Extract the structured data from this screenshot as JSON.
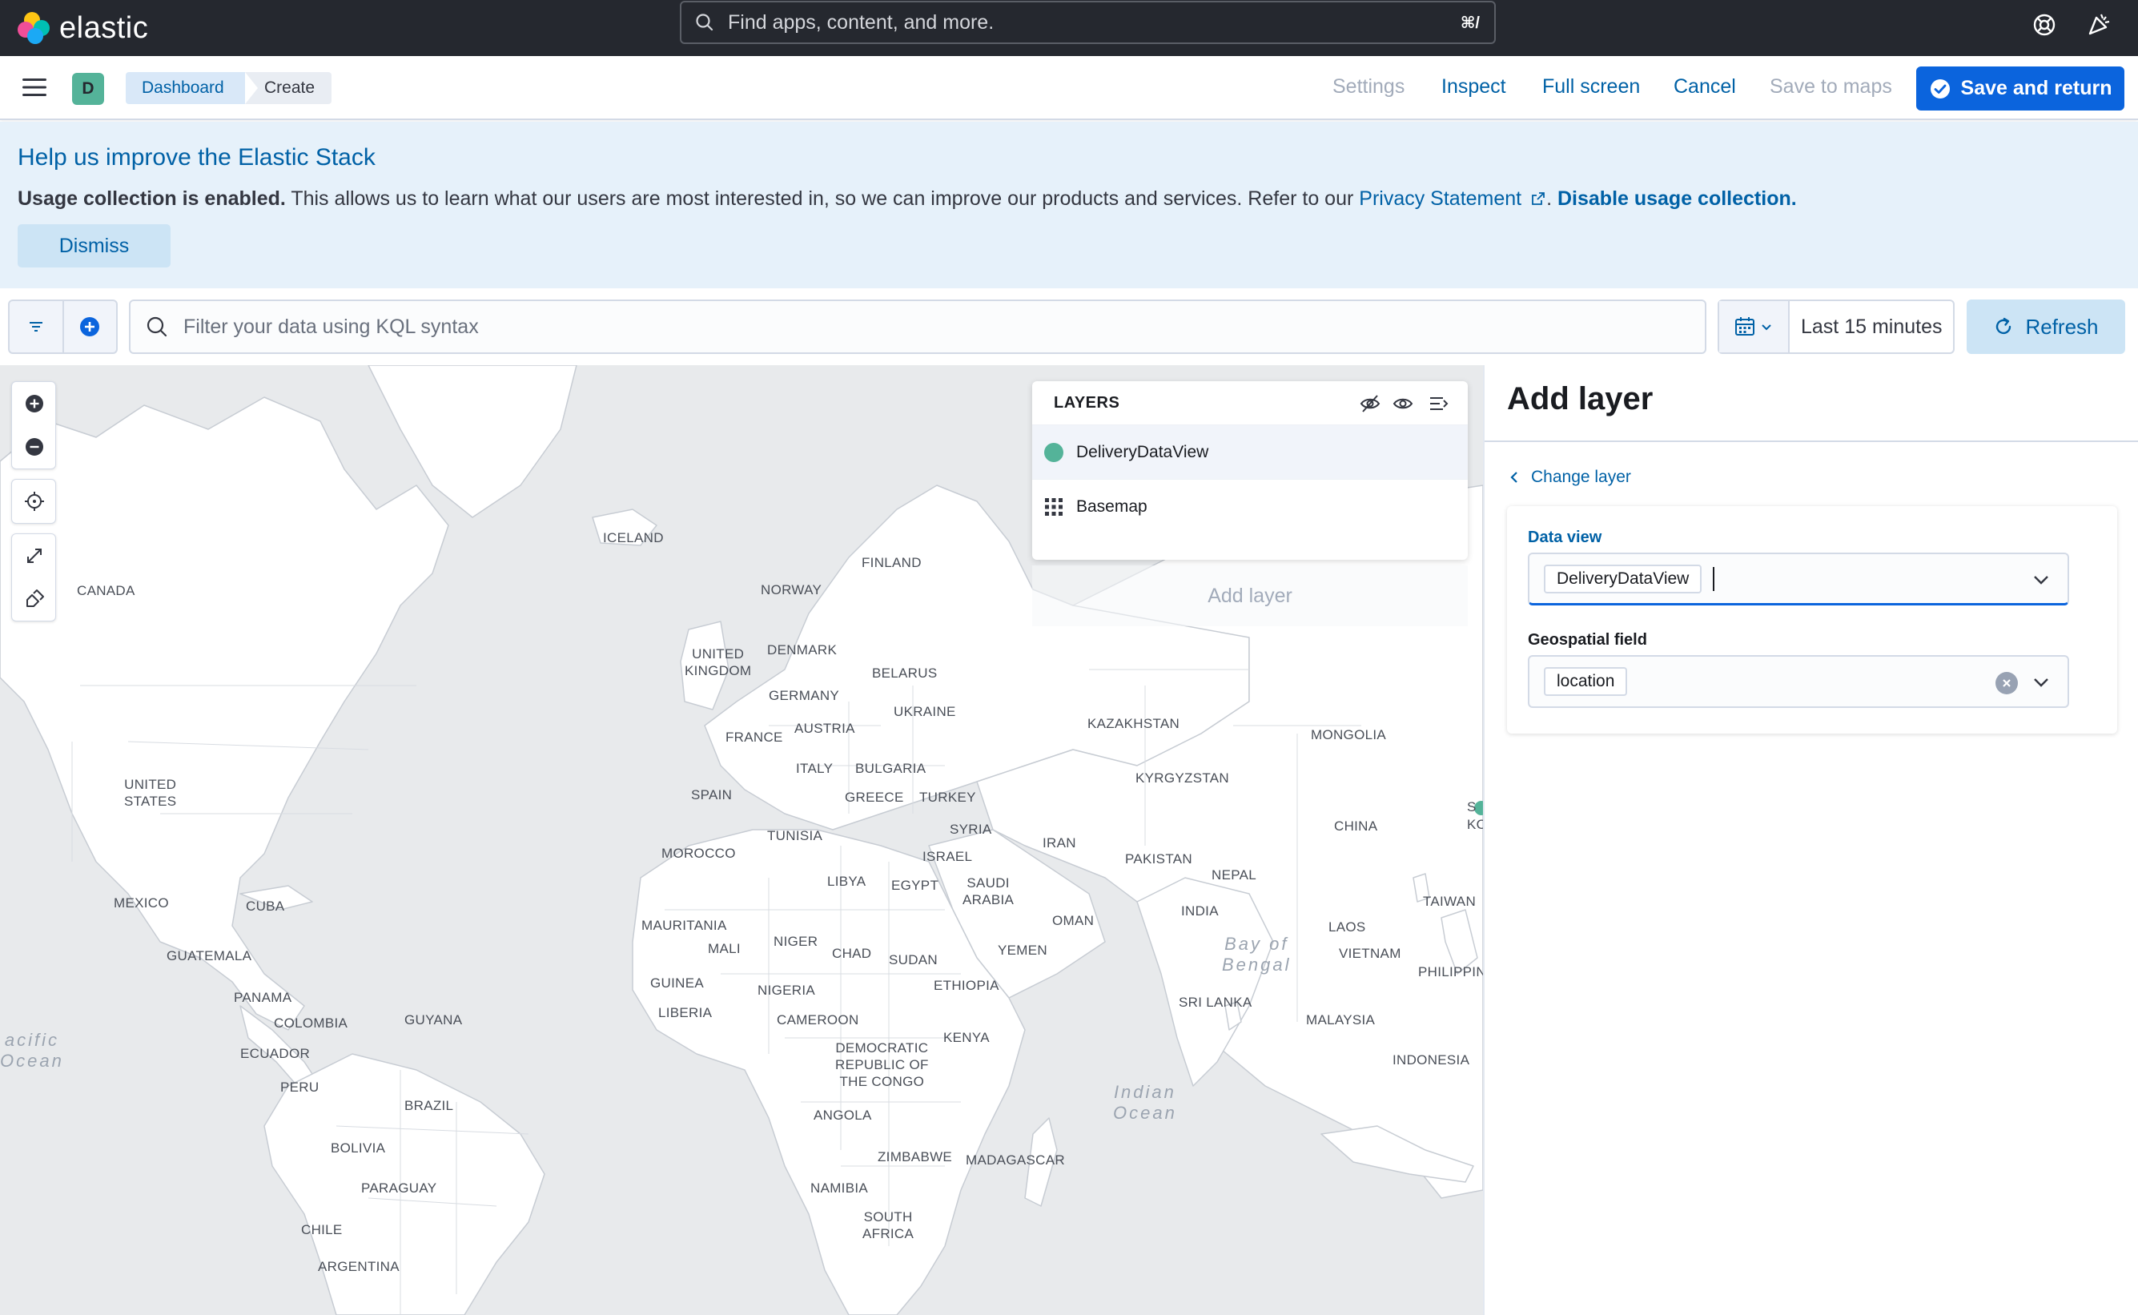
{
  "header": {
    "brand": "elastic",
    "search_placeholder": "Find apps, content, and more.",
    "search_shortcut": "⌘/",
    "icons": [
      "help-icon",
      "news-feed-icon"
    ]
  },
  "appbar": {
    "space_initial": "D",
    "breadcrumbs": [
      "Dashboard",
      "Create"
    ],
    "links": {
      "settings": "Settings",
      "inspect": "Inspect",
      "full_screen": "Full screen",
      "cancel": "Cancel",
      "save_to_maps": "Save to maps"
    },
    "primary_button": "Save and return"
  },
  "callout": {
    "title": "Help us improve the Elastic Stack",
    "bold_lead": "Usage collection is enabled.",
    "body": " This allows us to learn what our users are most interested in, so we can improve our products and services. Refer to our ",
    "privacy_link": "Privacy Statement",
    "separator": ". ",
    "disable_link": "Disable usage collection.",
    "dismiss": "Dismiss"
  },
  "query": {
    "placeholder": "Filter your data using KQL syntax",
    "time_range": "Last 15 minutes",
    "refresh": "Refresh"
  },
  "layers_panel": {
    "title": "LAYERS",
    "items": [
      {
        "label": "DeliveryDataView",
        "icon": "dot-icon",
        "color": "#54b399"
      },
      {
        "label": "Basemap",
        "icon": "grid-icon"
      }
    ],
    "add_layer": "Add layer"
  },
  "map_labels": {
    "iceland": "ICELAND",
    "finland": "FINLAND",
    "norway": "NORWAY",
    "canada": "CANADA",
    "united_kingdom": "UNITED\nKINGDOM",
    "denmark": "DENMARK",
    "belarus": "BELARUS",
    "germany": "GERMANY",
    "ukraine": "UKRAINE",
    "france": "FRANCE",
    "austria": "AUSTRIA",
    "kazakhstan": "KAZAKHSTAN",
    "mongolia": "MONGOLIA",
    "bulgaria": "BULGARIA",
    "italy": "ITALY",
    "kyrgyzstan": "KYRGYZSTAN",
    "united_states": "UNITED\nSTATES",
    "spain": "SPAIN",
    "greece": "GREECE",
    "turkey": "TURKEY",
    "syria": "SYRIA",
    "tunisia": "TUNISIA",
    "china": "CHINA",
    "iran": "IRAN",
    "morocco": "MOROCCO",
    "israel": "ISRAEL",
    "pakistan": "PAKISTAN",
    "nepal": "NEPAL",
    "libya": "LIBYA",
    "egypt": "EGYPT",
    "saudi_arabia": "SAUDI\nARABIA",
    "mexico": "MEXICO",
    "cuba": "CUBA",
    "taiwan": "TAIWAN",
    "india": "INDIA",
    "mauritania": "MAURITANIA",
    "oman": "OMAN",
    "laos": "LAOS",
    "niger": "NIGER",
    "mali": "MALI",
    "chad": "CHAD",
    "sudan": "SUDAN",
    "yemen": "YEMEN",
    "guatemala": "GUATEMALA",
    "vietnam": "VIETNAM",
    "philippines": "PHILIPPIN",
    "guinea": "GUINEA",
    "nigeria": "NIGERIA",
    "ethiopia": "ETHIOPIA",
    "panama": "PANAMA",
    "sri_lanka": "SRI LANKA",
    "malaysia": "MALAYSIA",
    "liberia": "LIBERIA",
    "colombia": "COLOMBIA",
    "guyana": "GUYANA",
    "cameroon": "CAMEROON",
    "kenya": "KENYA",
    "ecuador": "ECUADOR",
    "democratic_republic": "DEMOCRATIC\nREPUBLIC OF\nTHE CONGO",
    "indonesia": "INDONESIA",
    "peru": "PERU",
    "brazil": "BRAZIL",
    "angola": "ANGOLA",
    "bolivia": "BOLIVIA",
    "zimbabwe": "ZIMBABWE",
    "madagascar": "MADAGASCAR",
    "paraguay": "PARAGUAY",
    "namibia": "NAMIBIA",
    "south_africa": "SOUTH\nAFRICA",
    "chile": "CHILE",
    "argentina": "ARGENTINA",
    "s_cut": "S",
    "ko_cut": "KO",
    "bay_of_bengal": "Bay of\nBengal",
    "pacific_ocean": "acific\nOcean",
    "indian_ocean": "Indian\nOcean"
  },
  "side_panel": {
    "title": "Add layer",
    "back_link": "Change layer",
    "data_view_label": "Data view",
    "data_view_value": "DeliveryDataView",
    "geo_field_label": "Geospatial field",
    "geo_field_value": "location"
  },
  "colors": {
    "header_bg": "#25282f",
    "accent": "#0b64dd",
    "link": "#0061a6",
    "callout_bg": "#e6f1fa",
    "layer_dot": "#54b399",
    "map_bg": "#e8eaec"
  }
}
